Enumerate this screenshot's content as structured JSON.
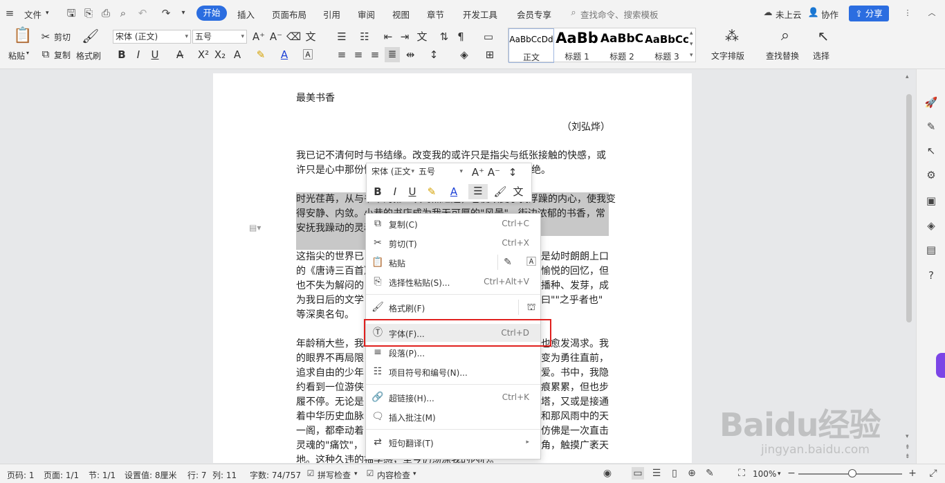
{
  "menubar": {
    "file": "文件",
    "tabs": [
      "开始",
      "插入",
      "页面布局",
      "引用",
      "审阅",
      "视图",
      "章节",
      "开发工具",
      "会员专享"
    ],
    "search_placeholder": "查找命令、搜索模板",
    "cloud": "未上云",
    "collab": "协作",
    "share": "分享"
  },
  "ribbon": {
    "paste": "粘贴",
    "cut": "剪切",
    "copy": "复制",
    "format_painter": "格式刷",
    "font_name": "宋体 (正文)",
    "font_size": "五号",
    "styles": [
      {
        "preview": "AaBbCcDd",
        "label": "正文"
      },
      {
        "preview": "AaBb",
        "label": "标题 1"
      },
      {
        "preview": "AaBbC",
        "label": "标题 2"
      },
      {
        "preview": "AaBbCc",
        "label": "标题 3"
      }
    ],
    "text_layout": "文字排版",
    "find_replace": "查找替换",
    "select": "选择"
  },
  "document": {
    "title": "最美书香",
    "author": "（刘弘烨）",
    "p1": [
      "我已记不清何时与书结缘。改变我的或许只是指尖与纸张接触的快感，或",
      "许只是心中那份憧"
    ],
    "p1_tail": "绝。",
    "p2": [
      "时光荏苒，从与书中的第一次蓦然过起，它便改变了我浮躁的内心，使我变",
      "得安静、内敛。小巷的书店成为我无可厚的\"风景\"，街边浓郁的书香，常",
      "安抚我躁动的灵魂"
    ],
    "p3_left": [
      "这指尖的世界已",
      "的《唐诗三百首》",
      "也不失为解闷的",
      "为我日后的文学",
      "等深奥名句。"
    ],
    "p3_right": [
      "是幼时朗朗上口",
      "愉悦的回忆，但",
      "播种、发芽，成",
      "曰\"\"之乎者也\"",
      ""
    ],
    "p4_left": [
      "年龄稍大些，我",
      "的眼界不再局限",
      "追求自由的少年",
      "约看到一位游侠",
      "履不停。无论是",
      "着中华历史血脉",
      "一阁，都牵动着",
      "灵魂的\"痛饮\"，",
      "地。这种久违的袖孚感，至今仍荡涤我的内心。"
    ],
    "p4_right": [
      "也愈发渴求。我",
      "变为勇往直前，",
      "爱。书中，我隐",
      "痕累累，但也步",
      "塔，又或是接通",
      "和那风雨中的天",
      "仿佛是一次直击",
      "角，触摸广袤天",
      ""
    ]
  },
  "mini_toolbar": {
    "font": "宋体 (正文",
    "size": "五号"
  },
  "context_menu": [
    {
      "label": "复制(C)",
      "shortcut": "Ctrl+C",
      "icon": "copy-icon"
    },
    {
      "label": "剪切(T)",
      "shortcut": "Ctrl+X",
      "icon": "scissors-icon"
    },
    {
      "label": "粘贴",
      "shortcut": "",
      "icon": "paste-icon"
    },
    {
      "label": "选择性粘贴(S)...",
      "shortcut": "Ctrl+Alt+V",
      "icon": "paste-special-icon"
    },
    {
      "label": "格式刷(F)",
      "shortcut": "",
      "icon": "format-painter-icon"
    },
    {
      "label": "字体(F)...",
      "shortcut": "Ctrl+D",
      "icon": "font-icon"
    },
    {
      "label": "段落(P)...",
      "shortcut": "",
      "icon": "paragraph-icon"
    },
    {
      "label": "项目符号和编号(N)...",
      "shortcut": "",
      "icon": "list-icon"
    },
    {
      "label": "超链接(H)...",
      "shortcut": "Ctrl+K",
      "icon": "link-icon"
    },
    {
      "label": "插入批注(M)",
      "shortcut": "",
      "icon": "comment-icon"
    },
    {
      "label": "短句翻译(T)",
      "shortcut": "",
      "icon": "translate-icon"
    }
  ],
  "status": {
    "page_num": "页码: 1",
    "pages": "页面: 1/1",
    "section": "节: 1/1",
    "setting": "设置值: 8厘米",
    "row": "行: 7",
    "col": "列: 11",
    "words": "字数: 74/757",
    "spell": "拼写检查",
    "content_check": "内容检查",
    "zoom": "100%"
  },
  "watermark": {
    "logo": "Baidu经验",
    "url": "jingyan.baidu.com"
  },
  "colors": {
    "accent": "#2b6de0",
    "highlight_box": "#e0201e",
    "selection": "#c8c8c8"
  }
}
